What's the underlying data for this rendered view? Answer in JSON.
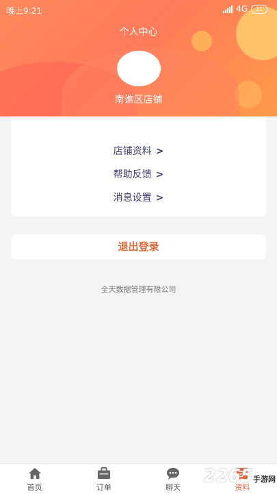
{
  "status_bar": {
    "time": "晚上9:21",
    "network": "4G",
    "battery": "11"
  },
  "header": {
    "title": "个人中心",
    "shop_name": "南谯区店铺"
  },
  "menu": {
    "items": [
      {
        "label": "店铺资料",
        "chevron": ">"
      },
      {
        "label": "帮助反馈",
        "chevron": ">"
      },
      {
        "label": "消息设置",
        "chevron": ">"
      }
    ]
  },
  "logout": {
    "label": "退出登录"
  },
  "footer": {
    "company": "全天数据管理有限公司"
  },
  "tabbar": {
    "tabs": [
      {
        "label": "首页",
        "icon": "home-icon"
      },
      {
        "label": "订单",
        "icon": "briefcase-icon"
      },
      {
        "label": "聊天",
        "icon": "chat-icon"
      },
      {
        "label": "资料",
        "icon": "profile-icon",
        "active": true
      }
    ]
  },
  "watermark": {
    "number": "2265",
    "text": "手游网"
  },
  "colors": {
    "accent": "#e9633d",
    "header_start": "#ff8a5c",
    "menu_text": "#3d3f6b"
  }
}
